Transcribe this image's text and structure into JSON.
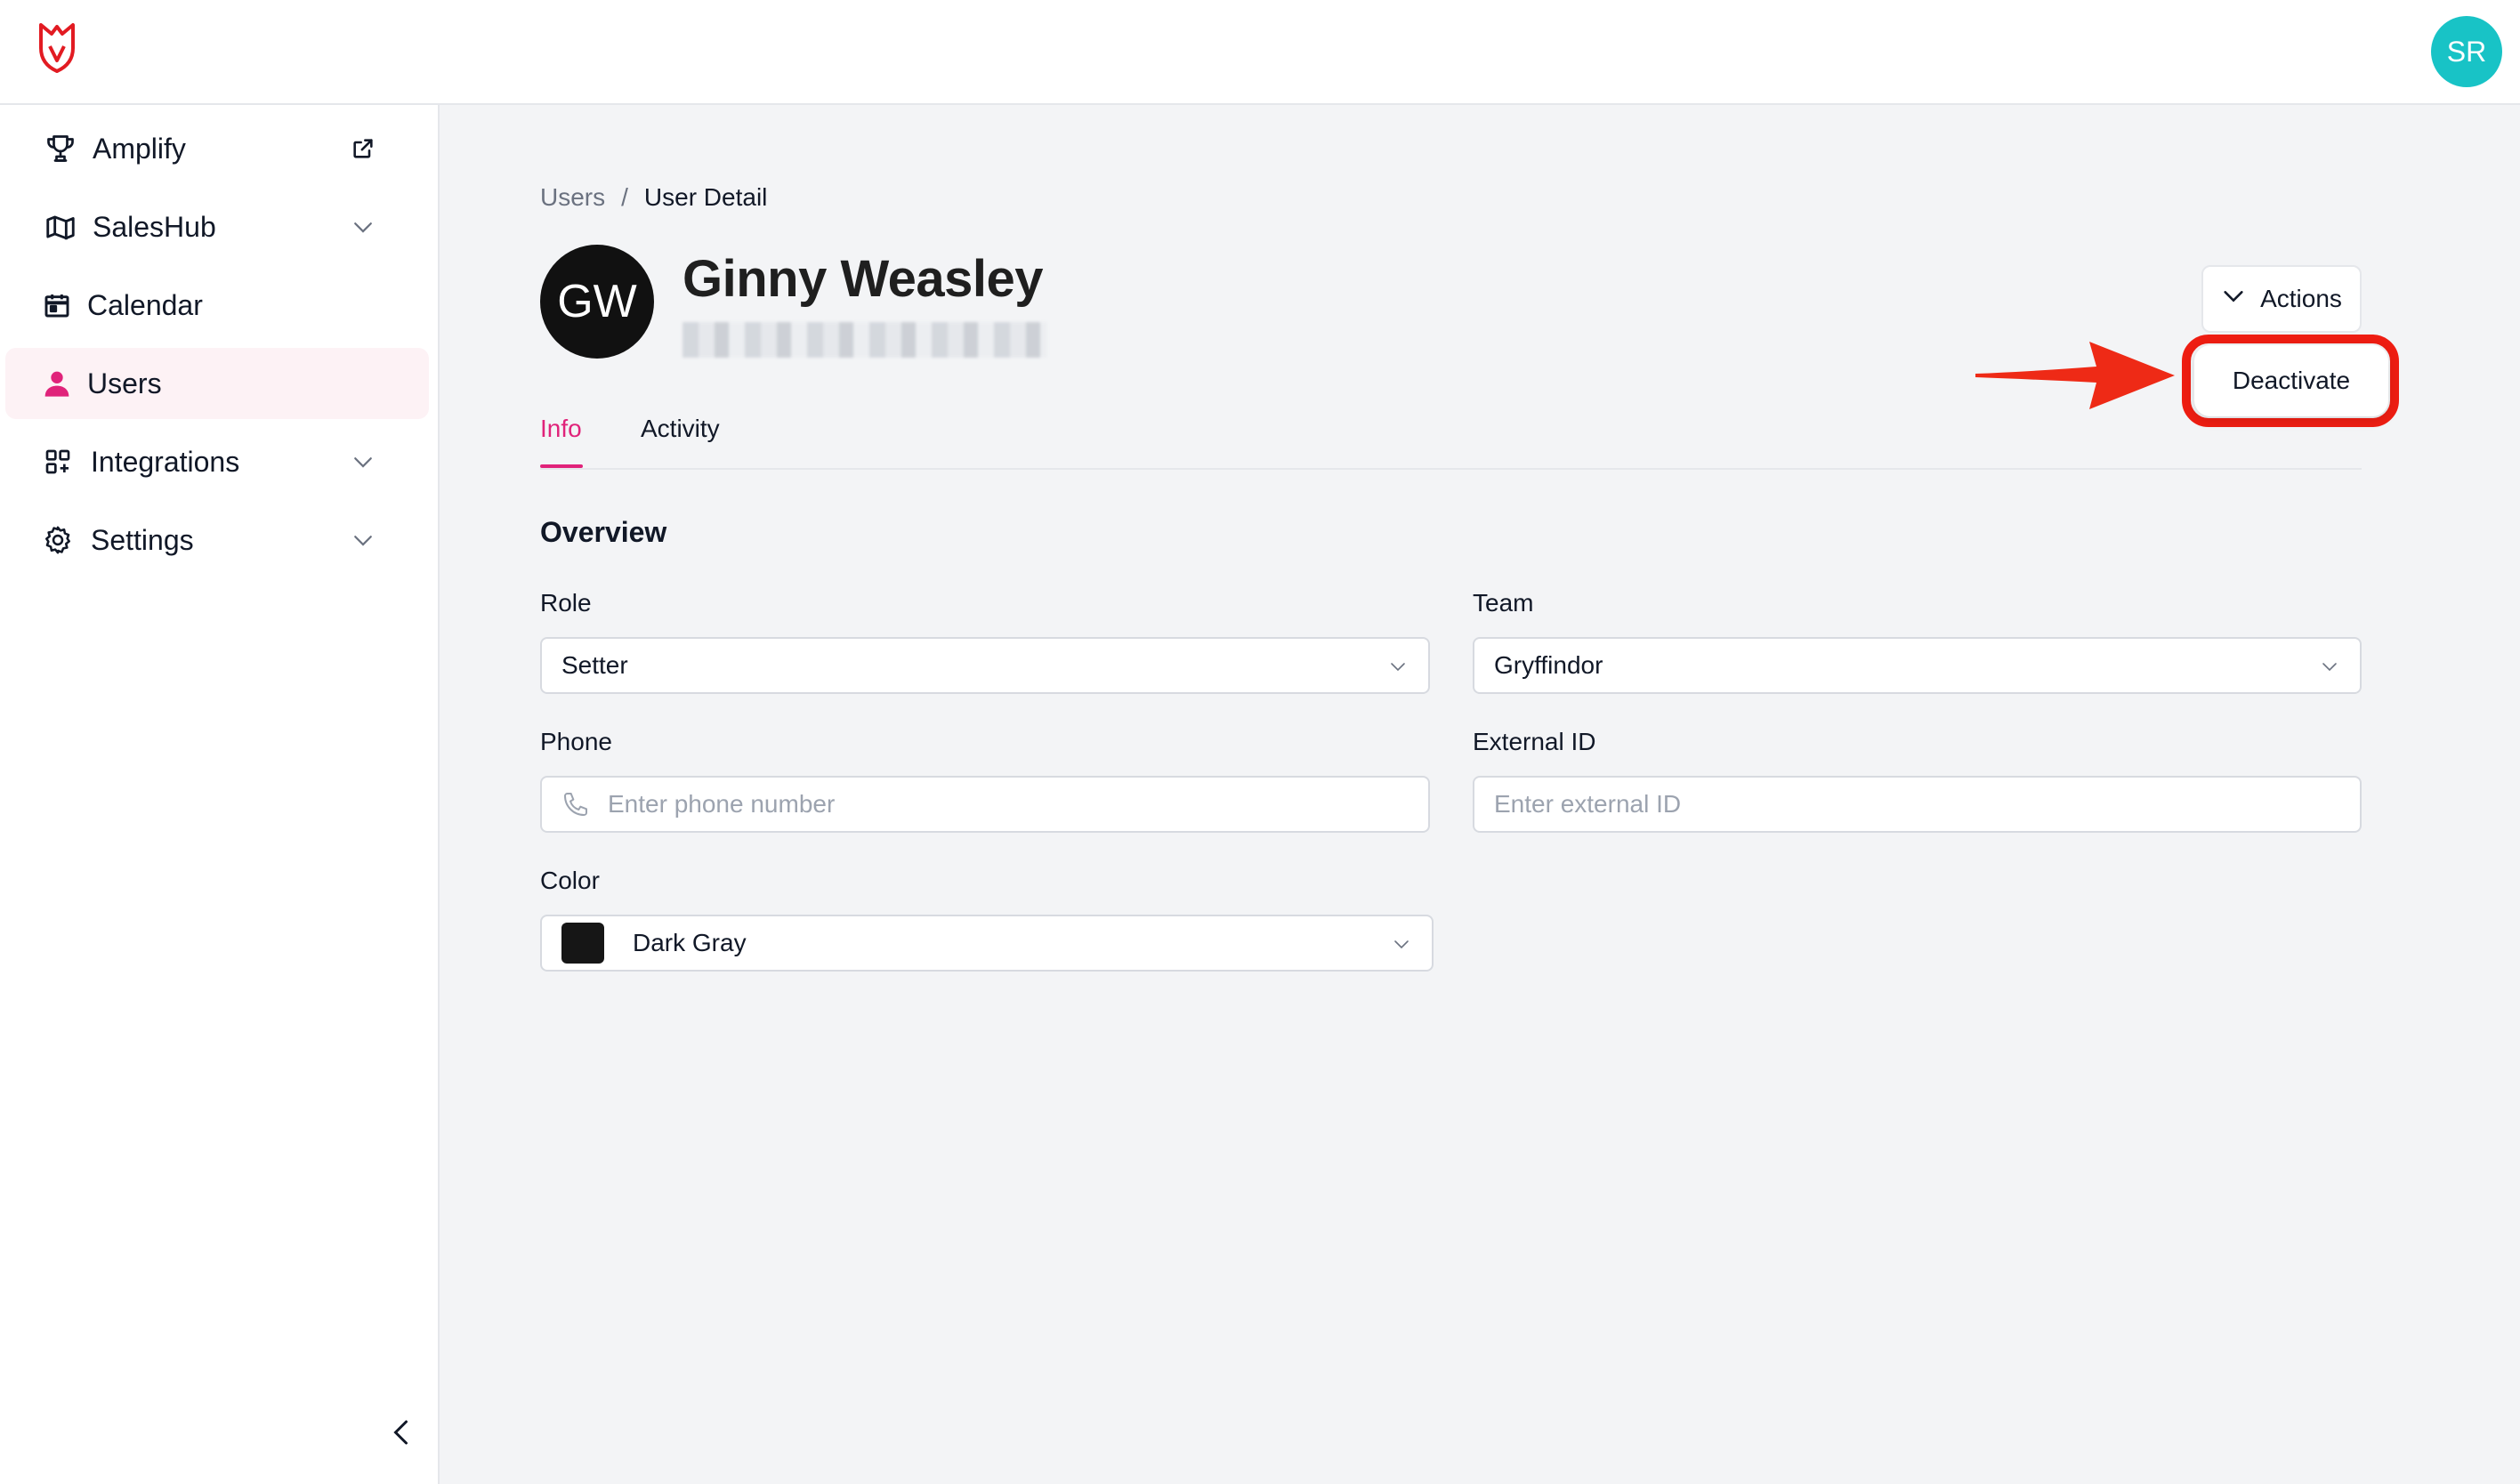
{
  "header": {
    "logo_icon": "fox-logo-icon",
    "user_initials": "SR",
    "avatar_color": "#18c3c6"
  },
  "sidebar": {
    "items": [
      {
        "label": "Amplify",
        "icon": "trophy-icon",
        "trailing_icon": "external-link-icon"
      },
      {
        "label": "SalesHub",
        "icon": "map-icon",
        "trailing_icon": "chevron-down-icon"
      },
      {
        "label": "Calendar",
        "icon": "calendar-icon"
      },
      {
        "label": "Users",
        "icon": "user-icon",
        "active": true
      },
      {
        "label": "Integrations",
        "icon": "grid-plus-icon",
        "trailing_icon": "chevron-down-icon"
      },
      {
        "label": "Settings",
        "icon": "gear-icon",
        "trailing_icon": "chevron-down-icon"
      }
    ],
    "collapse_icon": "chevron-left-icon"
  },
  "breadcrumb": {
    "parent": "Users",
    "separator": "/",
    "current": "User Detail"
  },
  "user": {
    "initials": "GW",
    "name": "Ginny Weasley"
  },
  "actions": {
    "label": "Actions",
    "menu_item": "Deactivate"
  },
  "tabs": [
    {
      "label": "Info",
      "active": true
    },
    {
      "label": "Activity"
    }
  ],
  "overview": {
    "title": "Overview",
    "role": {
      "label": "Role",
      "value": "Setter"
    },
    "team": {
      "label": "Team",
      "value": "Gryffindor"
    },
    "phone": {
      "label": "Phone",
      "placeholder": "Enter phone number"
    },
    "external_id": {
      "label": "External ID",
      "placeholder": "Enter external ID"
    },
    "color": {
      "label": "Color",
      "value": "Dark Gray",
      "swatch": "#161616"
    }
  },
  "colors": {
    "accent": "#e0237a",
    "highlight": "#ee1d12"
  }
}
